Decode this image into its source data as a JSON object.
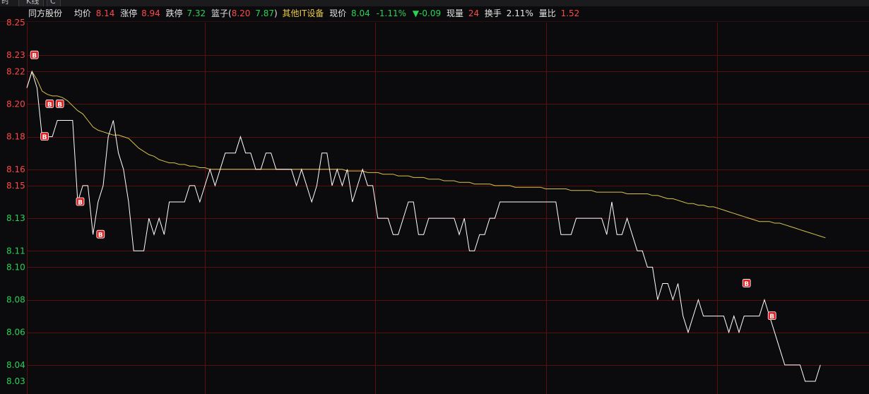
{
  "tabs": [
    {
      "label": "时"
    },
    {
      "label": "K线"
    },
    {
      "label": "C"
    }
  ],
  "info": {
    "stock_name": "同方股份",
    "avg_label": "均价",
    "avg_value": "8.14",
    "limit_up_label": "涨停",
    "limit_up_value": "8.94",
    "limit_down_label": "跌停",
    "limit_down_value": "7.32",
    "basket_label": "篮子(",
    "basket_v1": "8.20",
    "basket_v2": "7.87",
    "basket_close": ")",
    "sector": "其他IT设备",
    "price_label": "现价",
    "price_value": "8.04",
    "change_pct": "-1.11%",
    "change_value": "▼-0.09",
    "volume_label": "现量",
    "volume_value": "24",
    "turnover_label": "换手",
    "turnover_value": "2.11%",
    "ratio_label": "量比",
    "ratio_value": "1.52"
  },
  "colors": {
    "background": "#0b0b0d",
    "grid": "#5a0f0f",
    "price_line": "#ffffff",
    "avg_line": "#d8c24a",
    "up": "#ff4848",
    "down": "#2bd157"
  },
  "chart_data": {
    "type": "line",
    "ylim": [
      8.03,
      8.25
    ],
    "ticks": [
      {
        "v": 8.25,
        "label": "8.25",
        "color": "red"
      },
      {
        "v": 8.23,
        "label": "8.23",
        "color": "red"
      },
      {
        "v": 8.22,
        "label": "8.22",
        "color": "red"
      },
      {
        "v": 8.2,
        "label": "8.20",
        "color": "red"
      },
      {
        "v": 8.18,
        "label": "8.18",
        "color": "red"
      },
      {
        "v": 8.16,
        "label": "8.16",
        "color": "red"
      },
      {
        "v": 8.15,
        "label": "8.15",
        "color": "red"
      },
      {
        "v": 8.13,
        "label": "8.13",
        "color": "green"
      },
      {
        "v": 8.11,
        "label": "8.11",
        "color": "green"
      },
      {
        "v": 8.1,
        "label": "8.10",
        "color": "green"
      },
      {
        "v": 8.08,
        "label": "8.08",
        "color": "green"
      },
      {
        "v": 8.06,
        "label": "8.06",
        "color": "green"
      },
      {
        "v": 8.04,
        "label": "8.04",
        "color": "green"
      },
      {
        "v": 8.03,
        "label": "8.03",
        "color": "green"
      }
    ],
    "series": [
      {
        "key": "price",
        "values": [
          8.21,
          8.22,
          8.21,
          8.18,
          8.18,
          8.18,
          8.19,
          8.19,
          8.19,
          8.19,
          8.14,
          8.15,
          8.15,
          8.12,
          8.14,
          8.15,
          8.18,
          8.19,
          8.17,
          8.16,
          8.14,
          8.11,
          8.11,
          8.11,
          8.13,
          8.12,
          8.13,
          8.12,
          8.14,
          8.14,
          8.14,
          8.14,
          8.15,
          8.15,
          8.14,
          8.15,
          8.16,
          8.15,
          8.16,
          8.17,
          8.17,
          8.17,
          8.18,
          8.17,
          8.17,
          8.16,
          8.16,
          8.17,
          8.17,
          8.16,
          8.16,
          8.16,
          8.16,
          8.15,
          8.16,
          8.15,
          8.14,
          8.15,
          8.17,
          8.17,
          8.15,
          8.16,
          8.15,
          8.16,
          8.14,
          8.15,
          8.16,
          8.15,
          8.15,
          8.13,
          8.13,
          8.13,
          8.12,
          8.12,
          8.13,
          8.14,
          8.14,
          8.12,
          8.12,
          8.13,
          8.13,
          8.13,
          8.13,
          8.13,
          8.13,
          8.12,
          8.13,
          8.11,
          8.11,
          8.12,
          8.12,
          8.13,
          8.13,
          8.14,
          8.14,
          8.14,
          8.14,
          8.14,
          8.14,
          8.14,
          8.14,
          8.14,
          8.14,
          8.14,
          8.14,
          8.12,
          8.12,
          8.12,
          8.13,
          8.13,
          8.13,
          8.13,
          8.13,
          8.13,
          8.12,
          8.14,
          8.12,
          8.12,
          8.13,
          8.12,
          8.11,
          8.11,
          8.1,
          8.1,
          8.08,
          8.09,
          8.09,
          8.08,
          8.09,
          8.07,
          8.06,
          8.07,
          8.08,
          8.07,
          8.07,
          8.07,
          8.07,
          8.07,
          8.06,
          8.07,
          8.06,
          8.07,
          8.07,
          8.07,
          8.07,
          8.08,
          8.07,
          8.06,
          8.05,
          8.04,
          8.04,
          8.04,
          8.04,
          8.03,
          8.03,
          8.03,
          8.04
        ]
      },
      {
        "key": "average",
        "values": [
          8.21,
          8.22,
          8.215,
          8.208,
          8.206,
          8.205,
          8.205,
          8.204,
          8.202,
          8.199,
          8.196,
          8.194,
          8.19,
          8.186,
          8.184,
          8.183,
          8.182,
          8.181,
          8.181,
          8.18,
          8.179,
          8.176,
          8.173,
          8.171,
          8.169,
          8.168,
          8.166,
          8.165,
          8.164,
          8.164,
          8.163,
          8.163,
          8.162,
          8.162,
          8.161,
          8.161,
          8.16,
          8.16,
          8.16,
          8.16,
          8.16,
          8.16,
          8.16,
          8.16,
          8.16,
          8.16,
          8.16,
          8.16,
          8.16,
          8.16,
          8.16,
          8.16,
          8.16,
          8.16,
          8.16,
          8.16,
          8.16,
          8.16,
          8.16,
          8.16,
          8.16,
          8.16,
          8.16,
          8.159,
          8.159,
          8.159,
          8.159,
          8.158,
          8.158,
          8.158,
          8.157,
          8.157,
          8.157,
          8.156,
          8.156,
          8.156,
          8.155,
          8.155,
          8.155,
          8.154,
          8.154,
          8.154,
          8.153,
          8.153,
          8.153,
          8.152,
          8.152,
          8.152,
          8.151,
          8.151,
          8.151,
          8.151,
          8.15,
          8.15,
          8.15,
          8.15,
          8.149,
          8.149,
          8.149,
          8.149,
          8.149,
          8.149,
          8.148,
          8.148,
          8.148,
          8.148,
          8.148,
          8.147,
          8.147,
          8.147,
          8.147,
          8.147,
          8.146,
          8.146,
          8.146,
          8.146,
          8.146,
          8.146,
          8.145,
          8.145,
          8.145,
          8.145,
          8.145,
          8.144,
          8.144,
          8.143,
          8.142,
          8.142,
          8.141,
          8.14,
          8.139,
          8.139,
          8.138,
          8.138,
          8.137,
          8.137,
          8.136,
          8.135,
          8.134,
          8.133,
          8.132,
          8.131,
          8.13,
          8.129,
          8.128,
          8.128,
          8.128,
          8.127,
          8.127,
          8.126,
          8.125,
          8.124,
          8.123,
          8.122,
          8.121,
          8.12,
          8.119,
          8.118
        ]
      }
    ],
    "markers": [
      {
        "label": "B",
        "index": 1,
        "value": 8.23
      },
      {
        "label": "B",
        "index": 3,
        "value": 8.18
      },
      {
        "label": "B",
        "index": 4,
        "value": 8.2
      },
      {
        "label": "B",
        "index": 6,
        "value": 8.2
      },
      {
        "label": "B",
        "index": 10,
        "value": 8.14
      },
      {
        "label": "B",
        "index": 14,
        "value": 8.12
      },
      {
        "label": "B",
        "index": 141,
        "value": 8.09
      },
      {
        "label": "B",
        "index": 146,
        "value": 8.07
      }
    ]
  }
}
